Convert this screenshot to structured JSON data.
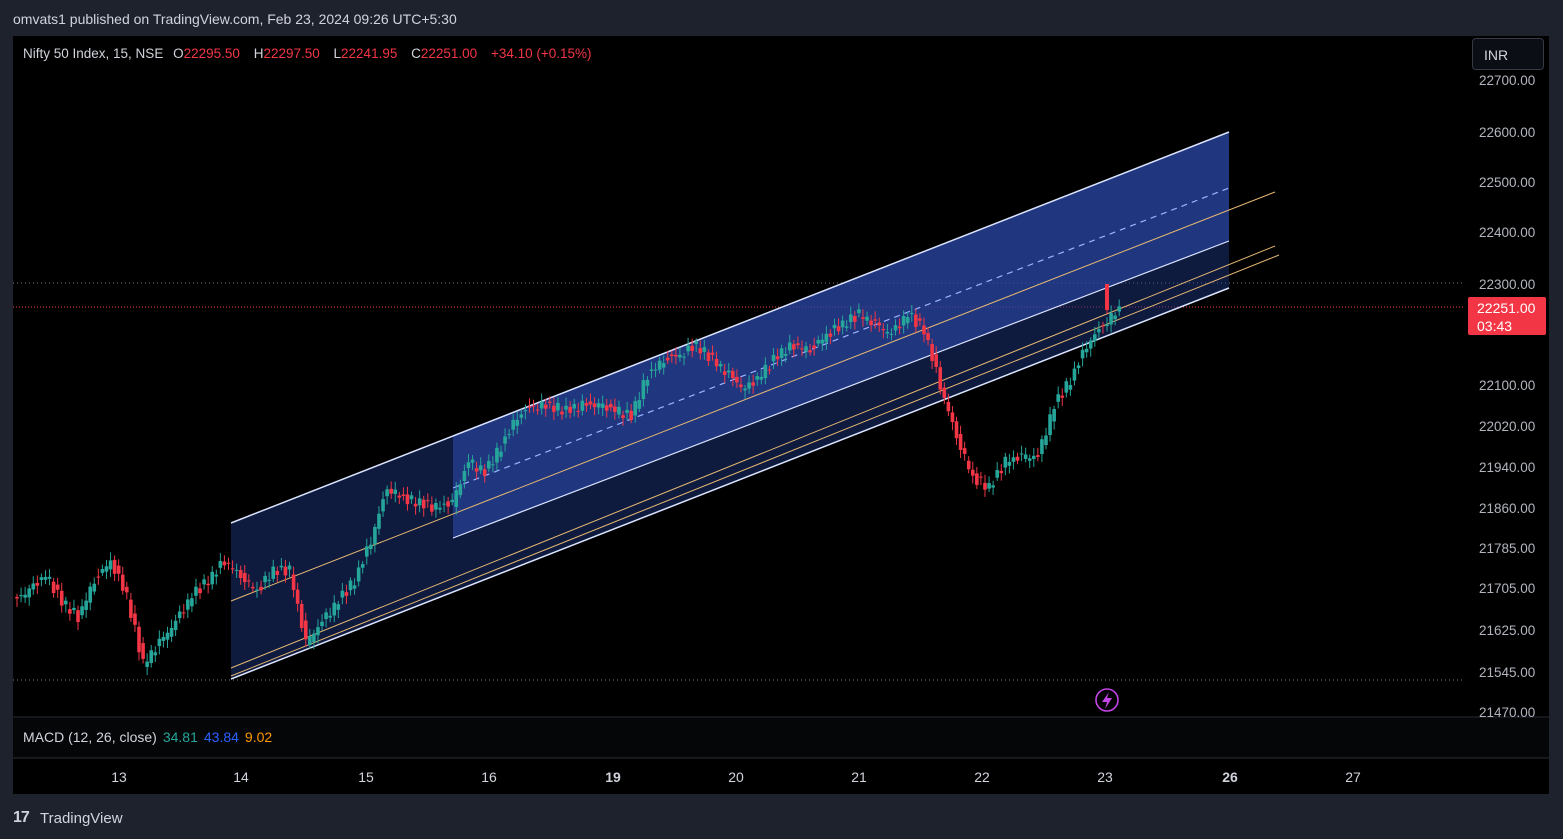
{
  "header": {
    "published_by": "omvats1 published on TradingView.com, Feb 23, 2024 09:26 UTC+5:30"
  },
  "symbol": {
    "name": "Nifty 50 Index, 15, NSE",
    "open_label": "O",
    "open": "22295.50",
    "high_label": "H",
    "high": "22297.50",
    "low_label": "L",
    "low": "22241.95",
    "close_label": "C",
    "close": "22251.00",
    "change": "+34.10 (+0.15%)"
  },
  "currency_button": "INR",
  "price_axis": {
    "ticks": [
      "22700.00",
      "22600.00",
      "22500.00",
      "22400.00",
      "22300.00",
      "22100.00",
      "22020.00",
      "21940.00",
      "21860.00",
      "21785.00",
      "21705.00",
      "21625.00",
      "21545.00",
      "21470.00"
    ]
  },
  "last_price": {
    "value": "22251.00",
    "countdown": "03:43"
  },
  "macd": {
    "label": "MACD (12, 26, close)",
    "macd": "34.81",
    "signal": "43.84",
    "hist": "9.02"
  },
  "time_axis": {
    "ticks": [
      {
        "label": "13",
        "bold": false
      },
      {
        "label": "14",
        "bold": false
      },
      {
        "label": "15",
        "bold": false
      },
      {
        "label": "16",
        "bold": false
      },
      {
        "label": "19",
        "bold": true
      },
      {
        "label": "20",
        "bold": false
      },
      {
        "label": "21",
        "bold": false
      },
      {
        "label": "22",
        "bold": false
      },
      {
        "label": "23",
        "bold": false
      },
      {
        "label": "26",
        "bold": true
      },
      {
        "label": "27",
        "bold": false
      }
    ]
  },
  "footer": {
    "logo": "17",
    "brand": "TradingView"
  },
  "colors": {
    "up": "#26a69a",
    "down": "#f23645",
    "channel_fill": "#1e3a8a",
    "channel_line": "#dbe4ff",
    "fib_line": "#e6b873",
    "background": "#000000"
  },
  "icons": {
    "alert": "lightning-icon"
  },
  "chart_data": {
    "type": "candlestick",
    "title": "Nifty 50 Index, 15, NSE",
    "ylim": [
      21470,
      22700
    ],
    "x_labels": [
      "13",
      "14",
      "15",
      "16",
      "19",
      "20",
      "21",
      "22",
      "23",
      "26",
      "27"
    ],
    "last_close": 22251.0,
    "approx_closes": [
      21700,
      21730,
      21680,
      21650,
      21720,
      21760,
      21690,
      21560,
      21600,
      21640,
      21690,
      21720,
      21760,
      21730,
      21700,
      21740,
      21740,
      21600,
      21640,
      21680,
      21720,
      21800,
      21900,
      21880,
      21870,
      21860,
      21870,
      21950,
      21930,
      21980,
      22040,
      22060,
      22060,
      22050,
      22060,
      22060,
      22050,
      22040,
      22120,
      22150,
      22160,
      22180,
      22150,
      22120,
      22090,
      22120,
      22160,
      22180,
      22170,
      22200,
      22220,
      22240,
      22220,
      22200,
      22240,
      22210,
      22100,
      22000,
      21920,
      21900,
      21950,
      21960,
      21960,
      22060,
      22110,
      22180,
      22220,
      22251
    ]
  }
}
